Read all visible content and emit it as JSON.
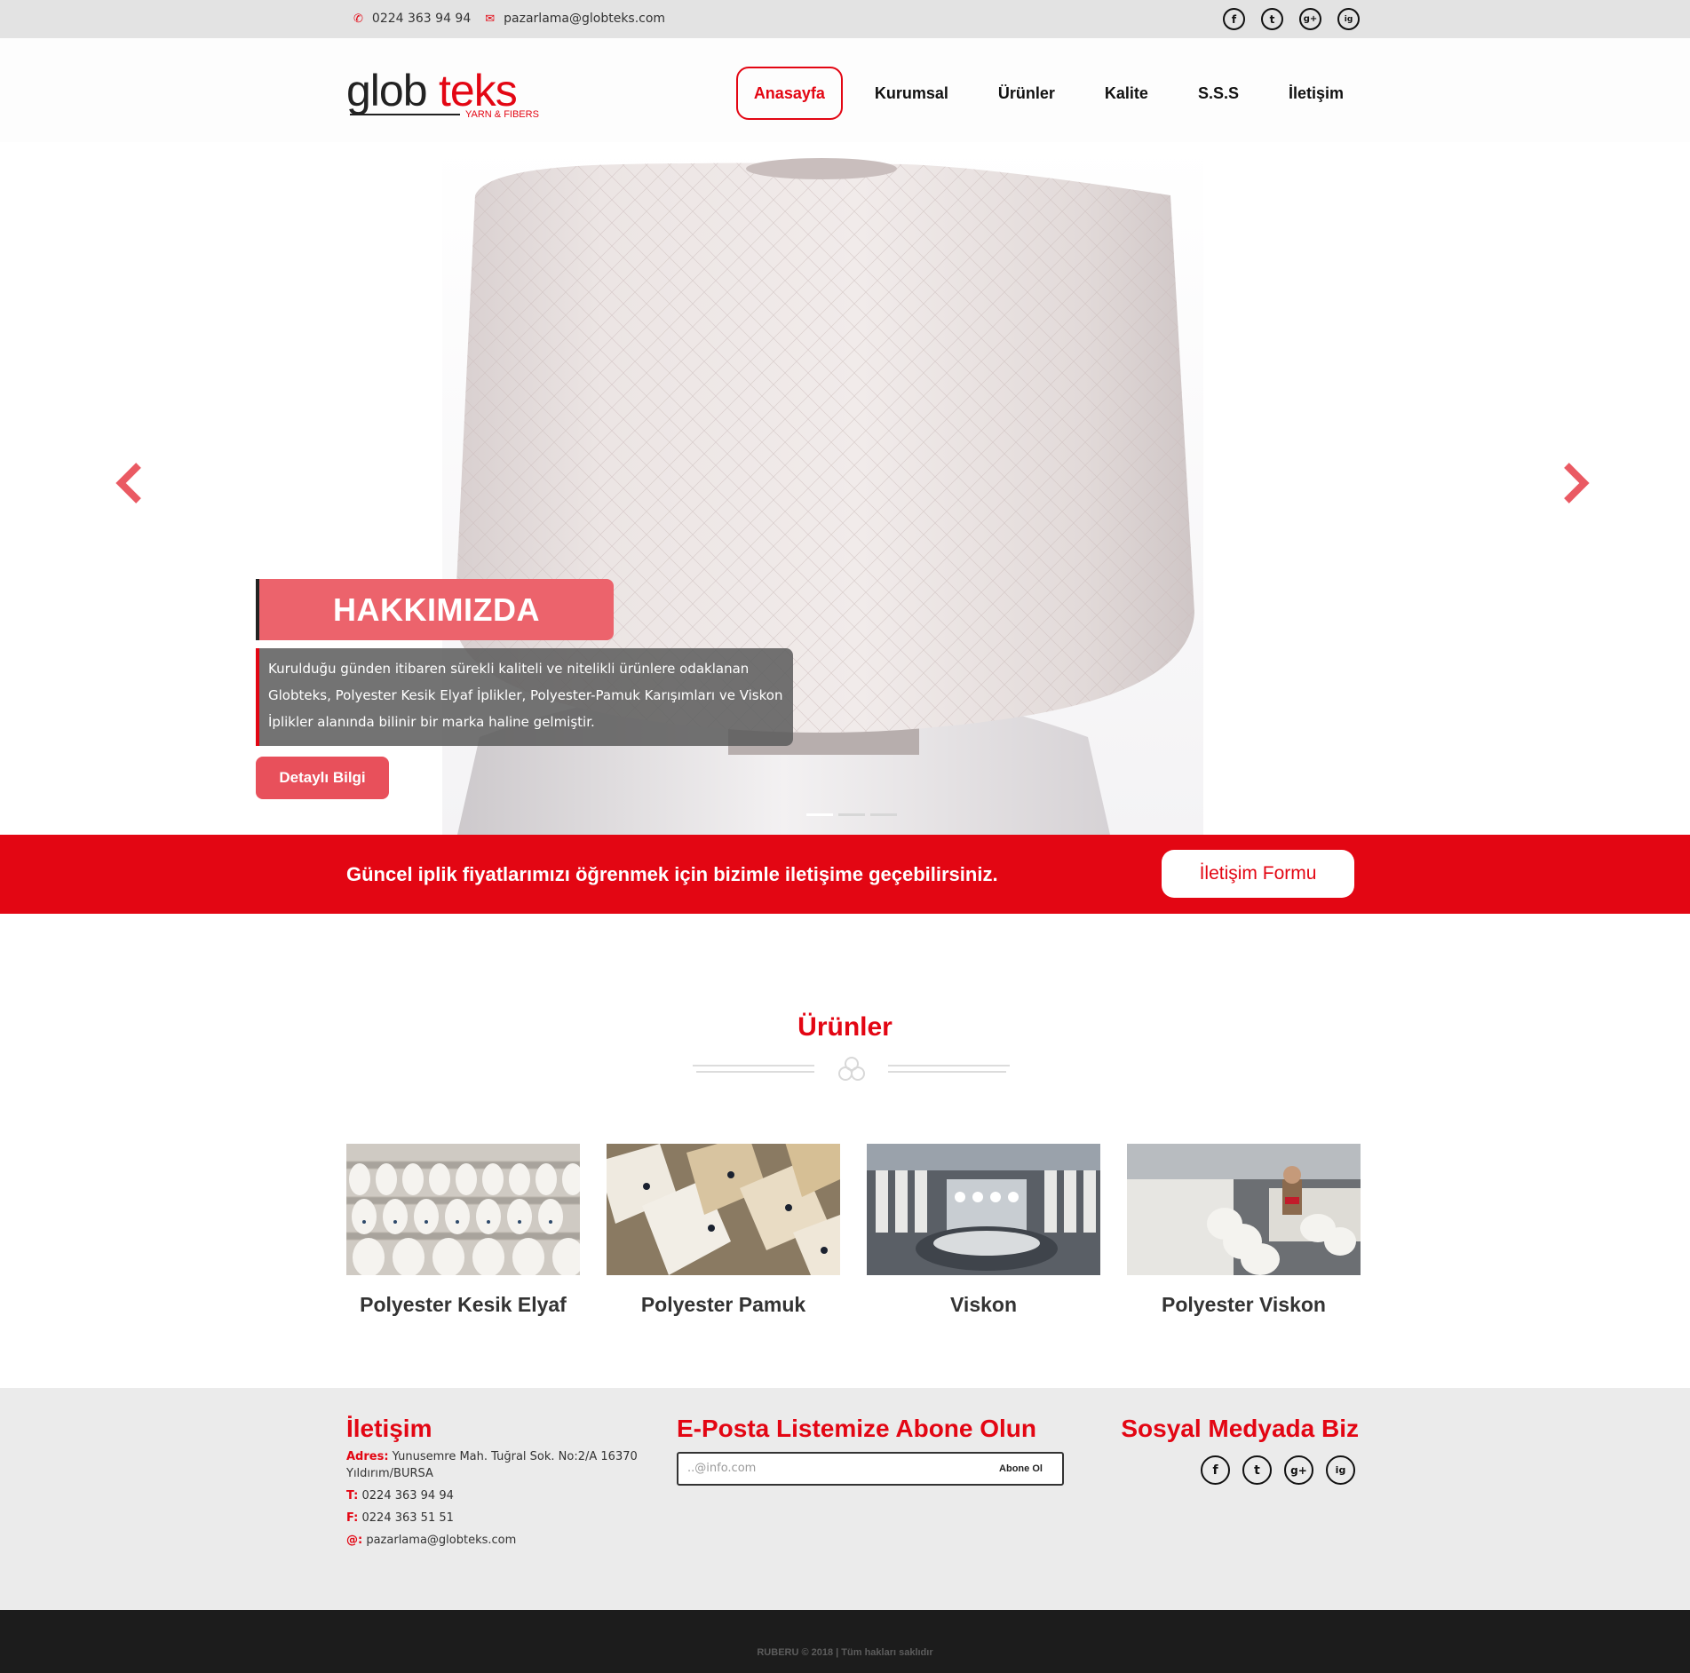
{
  "topbar": {
    "phone": "0224 363 94 94",
    "email": "pazarlama@globteks.com",
    "social": [
      "f",
      "t",
      "g+",
      "ig"
    ]
  },
  "header": {
    "logo_word_a": "glob",
    "logo_word_b": "teks",
    "logo_tagline": "YARN & FIBERS",
    "nav": [
      "Anasayfa",
      "Kurumsal",
      "Ürünler",
      "Kalite",
      "S.S.S",
      "İletişim"
    ]
  },
  "slider": {
    "title": "HAKKIMIZDA",
    "text": "Kurulduğu günden itibaren sürekli kaliteli ve nitelikli ürünlere odaklanan Globteks, Polyester Kesik Elyaf İplikler, Polyester-Pamuk Karışımları ve Viskon İplikler alanında bilinir bir marka haline gelmiştir.",
    "button": "Detaylı Bilgi",
    "active_slide": 1,
    "slide_count": 3
  },
  "cta": {
    "text": "Güncel iplik fiyatlarımızı öğrenmek için bizimle iletişime geçebilirsiniz.",
    "button": "İletişim Formu"
  },
  "products": {
    "title": "Ürünler",
    "items": [
      "Polyester Kesik Elyaf",
      "Polyester Pamuk",
      "Viskon",
      "Polyester Viskon"
    ]
  },
  "footer": {
    "contact_title": "İletişim",
    "address_label": "Adres:",
    "address": "Yunusemre Mah. Tuğral Sok. No:2/A 16370 Yıldırım/BURSA",
    "phone_label": "T:",
    "phone": "0224 363 94 94",
    "fax_label": "F:",
    "fax": "0224 363 51 51",
    "email_label": "@:",
    "email": "pazarlama@globteks.com",
    "subscribe_title": "E-Posta Listemize Abone Olun",
    "subscribe_placeholder": "..@info.com",
    "subscribe_button": "Abone Ol",
    "social_title": "Sosyal Medyada Biz"
  },
  "copyright": "RUBERU © 2018 | Tüm hakları saklıdır",
  "colors": {
    "accent": "#e30613",
    "caption": "#ec636c",
    "button": "#e8505b"
  }
}
